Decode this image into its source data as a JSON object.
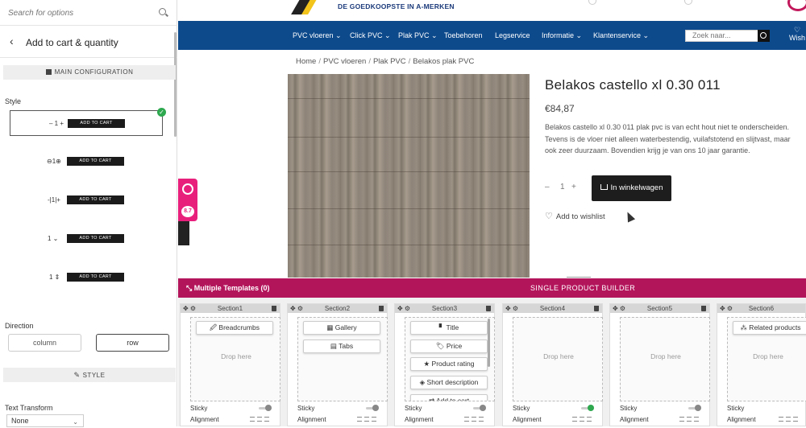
{
  "left_panel": {
    "search_placeholder": "Search for options",
    "back_icon": "chevron-left-icon",
    "title": "Add to cart & quantity",
    "main_config_label": "MAIN CONFIGURATION",
    "style_label": "Style",
    "style_options": [
      {
        "qty": "– 1 +",
        "btn": "ADD TO CART",
        "selected": true
      },
      {
        "qty": "⊖1⊕",
        "btn": "ADD TO CART",
        "selected": false
      },
      {
        "qty": "-|1|+",
        "btn": "ADD TO CART",
        "selected": false
      },
      {
        "qty": "1 ⌄",
        "btn": "ADD TO CART",
        "selected": false
      },
      {
        "qty": "1 ⇕",
        "btn": "ADD TO CART",
        "selected": false
      }
    ],
    "direction_label": "Direction",
    "direction_column": "column",
    "direction_row": "row",
    "direction_selected": "row",
    "style_section_label": "STYLE",
    "text_transform_label": "Text Transform",
    "text_transform_value": "None"
  },
  "site": {
    "tagline": "DE GOEDKOOPSTE IN A-MERKEN",
    "nav_items": [
      "PVC vloeren ⌄",
      "Click PVC ⌄",
      "Plak PVC ⌄",
      "Toebehoren",
      "Legservice",
      "Informatie ⌄",
      "Klantenservice ⌄"
    ],
    "search_placeholder": "Zoek naar...",
    "wishlist_label": "Wish",
    "breadcrumbs": [
      "Home",
      "PVC vloeren",
      "Plak PVC",
      "Belakos plak PVC"
    ],
    "breadcrumb_sep": "/",
    "product_title": "Belakos castello xl 0.30 011",
    "price": "€84,87",
    "description": "Belakos castello xl 0.30 011 plak pvc is van echt hout niet te onderscheiden. Tevens is de vloer niet alleen waterbestendig, vuilafstotend en slijtvast, maar ook zeer duurzaam. Bovendien krijg je van ons 10 jaar garantie.",
    "qty_minus": "–",
    "qty_value": "1",
    "qty_plus": "+",
    "cart_button": "In winkelwagen",
    "wishlist_link": "Add to wishlist",
    "review_score": "8.7",
    "nav_color": "#0d4a8c"
  },
  "builder": {
    "header_left": "Multiple Templates (0)",
    "header_center": "SINGLE PRODUCT BUILDER",
    "header_color": "#b3155b",
    "sections": [
      {
        "name": "Section1",
        "chips": [
          "🖉 Breadcrumbs"
        ],
        "drop": "Drop here",
        "sticky_on": false
      },
      {
        "name": "Section2",
        "chips": [
          "▦ Gallery",
          "▤ Tabs"
        ],
        "drop": "",
        "sticky_on": false
      },
      {
        "name": "Section3",
        "chips": [
          "▘ Title",
          "🏷 Price",
          "★ Product rating",
          "◈ Short description",
          "⇄ Add to cart"
        ],
        "drop": "",
        "sticky_on": false
      },
      {
        "name": "Section4",
        "chips": [],
        "drop": "Drop here",
        "sticky_on": true
      },
      {
        "name": "Section5",
        "chips": [],
        "drop": "Drop here",
        "sticky_on": false
      },
      {
        "name": "Section6",
        "chips": [
          "⁂ Related products"
        ],
        "drop": "Drop here",
        "sticky_on": false
      }
    ],
    "sticky_label": "Sticky",
    "alignment_label": "Alignment"
  }
}
